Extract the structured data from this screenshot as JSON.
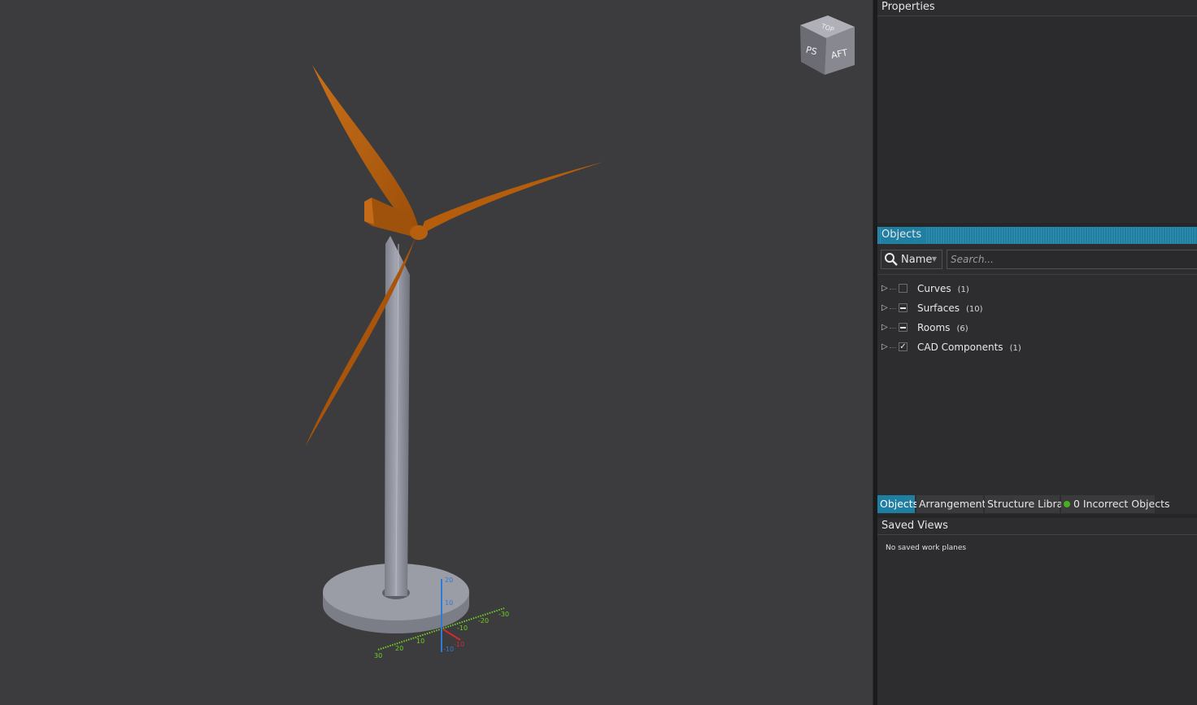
{
  "viewport": {
    "model": "wind-turbine",
    "colors": {
      "background": "#3c3c3e",
      "blades": "#b85f0e",
      "tower": "#8d8f99",
      "base": "#9a9ca6"
    },
    "view_cube": {
      "top_face": "TOP",
      "left_face": "PS",
      "front_face": "AFT"
    },
    "axes": {
      "x_labels": [
        "30",
        "20",
        "10",
        "-10",
        "-20",
        "-30"
      ],
      "y_labels": [
        "-10",
        "-10",
        "-10"
      ],
      "z_labels": [
        "10",
        "20"
      ],
      "colors": {
        "x": "#6fcf1f",
        "y": "#d42b2b",
        "z": "#2e7bd6"
      }
    }
  },
  "panel": {
    "properties": {
      "title": "Properties"
    },
    "objects": {
      "title": "Objects",
      "search": {
        "field_selector": "Name",
        "placeholder": "Search..."
      },
      "tree": [
        {
          "label": "Curves",
          "count": "(1)",
          "check": "unchecked"
        },
        {
          "label": "Surfaces",
          "count": "(10)",
          "check": "partial"
        },
        {
          "label": "Rooms",
          "count": "(6)",
          "check": "partial"
        },
        {
          "label": "CAD Components",
          "count": "(1)",
          "check": "checked"
        }
      ]
    },
    "tabs": {
      "objects": "Objects",
      "arrangements": "Arrangements",
      "structure_library": "Structure Library",
      "incorrect": "0 Incorrect Objects",
      "incorrect_status_color": "#4caf1f"
    },
    "saved_views": {
      "title": "Saved Views",
      "empty_message": "No saved work planes"
    }
  }
}
